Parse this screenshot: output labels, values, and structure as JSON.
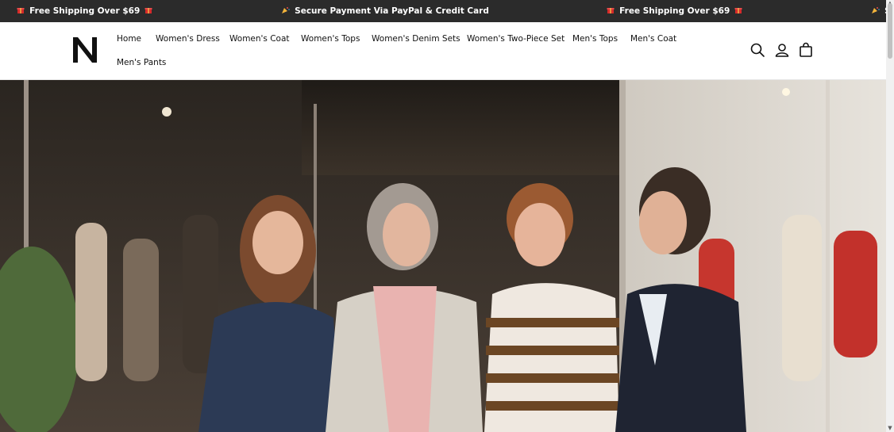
{
  "announcement": {
    "items": [
      {
        "icon": "gift-icon",
        "text": "Free Shipping Over $69"
      },
      {
        "icon": "party-popper-icon",
        "text": "Secure Payment Via PayPal & Credit Card"
      },
      {
        "icon": "gift-icon",
        "text": "Free Shipping Over $69"
      },
      {
        "icon": "party-popper-icon",
        "text": "Se"
      }
    ]
  },
  "logo": {
    "text": "N"
  },
  "nav": {
    "items": [
      "Home",
      "Women's Dress",
      "Women's Coat",
      "Women's Tops",
      "Women's Denim Sets",
      "Women's Two-Piece Set",
      "Men's Tops",
      "Men's Coat",
      "Men's Pants"
    ]
  },
  "header_icons": [
    "search-icon",
    "account-icon",
    "cart-icon"
  ],
  "colors": {
    "announcement_bg": "#2b2b2b",
    "text": "#111111",
    "accent": "#d62b2b"
  }
}
